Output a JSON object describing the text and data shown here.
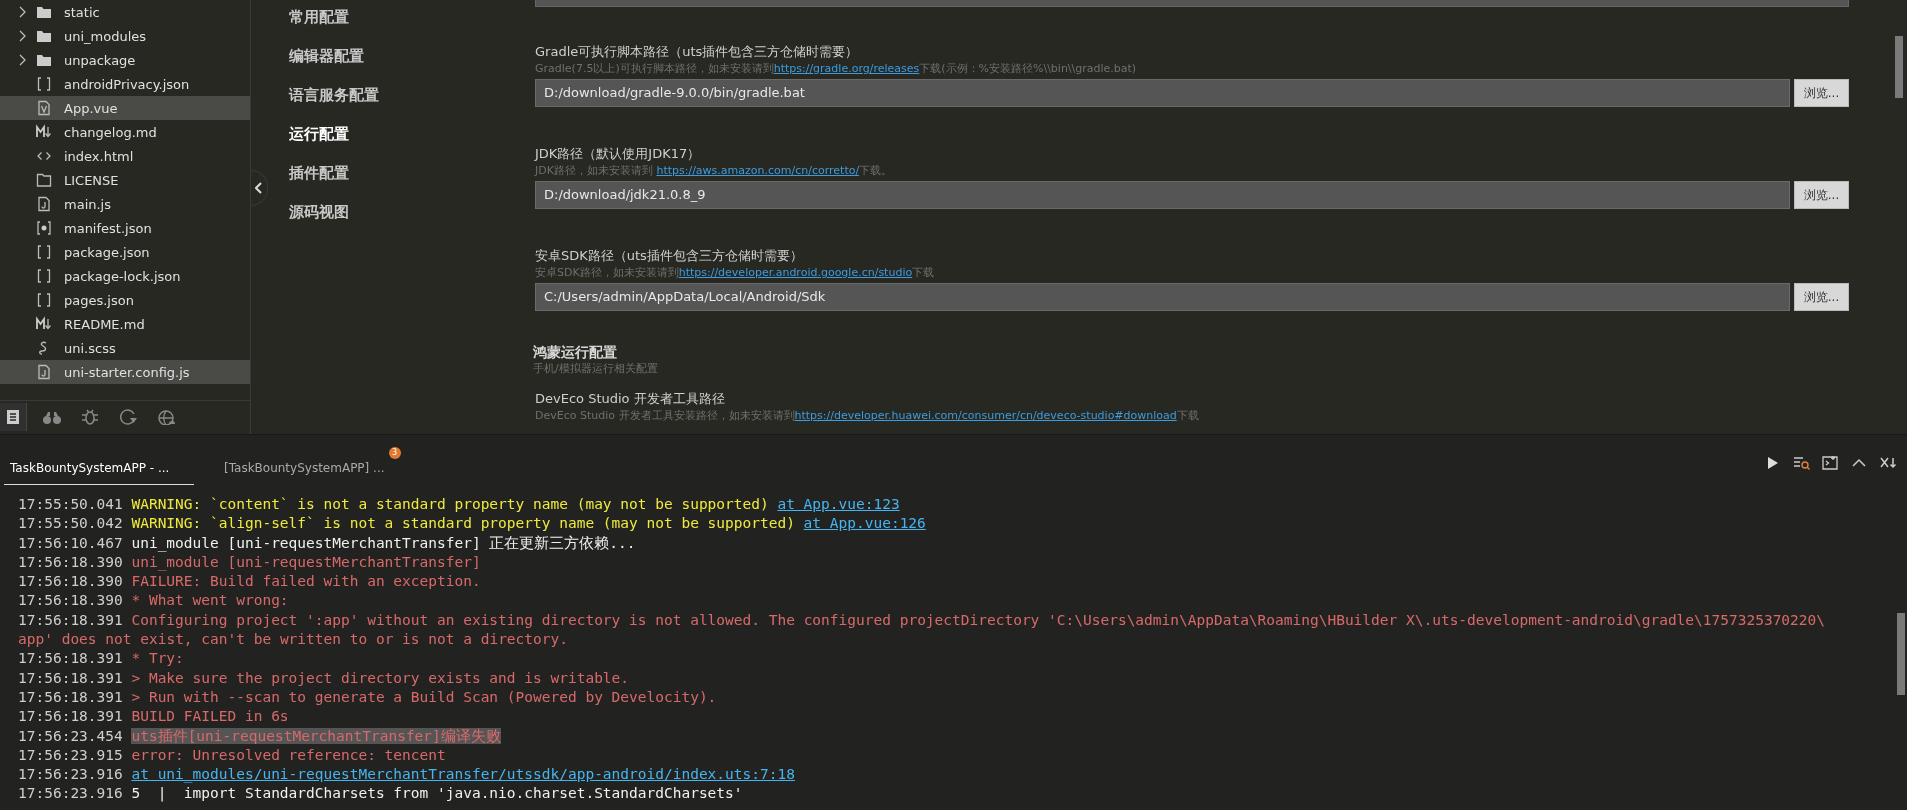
{
  "file_tree": {
    "items": [
      {
        "name": "static",
        "kind": "folder",
        "expandable": true,
        "selected": false
      },
      {
        "name": "uni_modules",
        "kind": "folder",
        "expandable": true,
        "selected": false
      },
      {
        "name": "unpackage",
        "kind": "folder",
        "expandable": true,
        "selected": false
      },
      {
        "name": "androidPrivacy.json",
        "kind": "brackets",
        "expandable": false,
        "selected": false
      },
      {
        "name": "App.vue",
        "kind": "vue",
        "expandable": false,
        "selected": true
      },
      {
        "name": "changelog.md",
        "kind": "markdown",
        "expandable": false,
        "selected": false
      },
      {
        "name": "index.html",
        "kind": "html",
        "expandable": false,
        "selected": false
      },
      {
        "name": "LICENSE",
        "kind": "file",
        "expandable": false,
        "selected": false
      },
      {
        "name": "main.js",
        "kind": "js",
        "expandable": false,
        "selected": false
      },
      {
        "name": "manifest.json",
        "kind": "manifest",
        "expandable": false,
        "selected": false
      },
      {
        "name": "package.json",
        "kind": "brackets",
        "expandable": false,
        "selected": false
      },
      {
        "name": "package-lock.json",
        "kind": "brackets",
        "expandable": false,
        "selected": false
      },
      {
        "name": "pages.json",
        "kind": "brackets",
        "expandable": false,
        "selected": false
      },
      {
        "name": "README.md",
        "kind": "markdown",
        "expandable": false,
        "selected": false
      },
      {
        "name": "uni.scss",
        "kind": "scss",
        "expandable": false,
        "selected": false
      },
      {
        "name": "uni-starter.config.js",
        "kind": "js",
        "expandable": false,
        "selected": true
      }
    ]
  },
  "activity_bar": [
    {
      "selected": true
    },
    {
      "selected": false
    },
    {
      "selected": false
    },
    {
      "selected": false
    },
    {
      "selected": false
    }
  ],
  "settings_nav": [
    {
      "label": "常用配置",
      "selected": false
    },
    {
      "label": "编辑器配置",
      "selected": false
    },
    {
      "label": "语言服务配置",
      "selected": false
    },
    {
      "label": "运行配置",
      "selected": true
    },
    {
      "label": "插件配置",
      "selected": false
    },
    {
      "label": "源码视图",
      "selected": false
    }
  ],
  "settings": [
    {
      "kind": "path",
      "title": "Gradle可执行脚本路径（uts插件包含三方仓储时需要）",
      "description": [
        {
          "text": "Gradle(7.5以上)可执行脚本路径，如未安装请到"
        },
        {
          "link": "https://gradle.org/releases"
        },
        {
          "text": "下载(示例：%安装路径%\\\\bin\\\\gradle.bat)"
        }
      ],
      "value": "D:/download/gradle-9.0.0/bin/gradle.bat",
      "button": "浏览..."
    },
    {
      "kind": "path",
      "title": "JDK路径（默认使用JDK17）",
      "description": [
        {
          "text": "JDK路径，如未安装请到 "
        },
        {
          "link": "https://aws.amazon.com/cn/corretto/"
        },
        {
          "text": "下载。"
        }
      ],
      "value": "D:/download/jdk21.0.8_9",
      "button": "浏览..."
    },
    {
      "kind": "path",
      "title": "安卓SDK路径（uts插件包含三方仓储时需要）",
      "description": [
        {
          "text": "安卓SDK路径，如未安装请到"
        },
        {
          "link": "https://developer.android.google.cn/studio"
        },
        {
          "text": "下载"
        }
      ],
      "value": "C:/Users/admin/AppData/Local/Android/Sdk",
      "button": "浏览..."
    },
    {
      "kind": "group",
      "title": "鸿蒙运行配置",
      "subtitle": "手机/模拟器运行相关配置"
    },
    {
      "kind": "path",
      "title": "DevEco Studio 开发者工具路径",
      "description": [
        {
          "text": "DevEco Studio 开发者工具安装路径，如未安装请到"
        },
        {
          "link": "https://developer.huawei.com/consumer/cn/deveco-studio#download"
        },
        {
          "text": "下载"
        }
      ]
    }
  ],
  "console": {
    "tabs": [
      {
        "label": "TaskBountySystemAPP - ...",
        "selected": true
      },
      {
        "label": "[TaskBountySystemAPP] ...",
        "selected": false,
        "badge": "3"
      }
    ],
    "lines": [
      {
        "time": "17:55:50.041",
        "segments": [
          {
            "kind": "warn",
            "text": "WARNING: `content` is not a standard property name (may not be supported)"
          },
          {
            "kind": "link",
            "text": "at App.vue:123"
          }
        ]
      },
      {
        "time": "17:55:50.042",
        "segments": [
          {
            "kind": "warn",
            "text": "WARNING: `align-self` is not a standard property name (may not be supported)"
          },
          {
            "kind": "link",
            "text": "at App.vue:126"
          }
        ]
      },
      {
        "time": "17:56:10.467",
        "segments": [
          {
            "kind": "info",
            "text": "uni_module [uni-requestMerchantTransfer] 正在更新三方依赖..."
          }
        ]
      },
      {
        "time": "17:56:18.390",
        "segments": [
          {
            "kind": "error",
            "text": "uni_module [uni-requestMerchantTransfer]"
          }
        ]
      },
      {
        "time": "17:56:18.390",
        "segments": [
          {
            "kind": "error",
            "text": "FAILURE: Build failed with an exception."
          }
        ]
      },
      {
        "time": "17:56:18.390",
        "segments": [
          {
            "kind": "error",
            "text": "* What went wrong:"
          }
        ]
      },
      {
        "time": "17:56:18.391",
        "segments": [
          {
            "kind": "error",
            "text": "Configuring project ':app' without an existing directory is not allowed. The configured projectDirectory 'C:\\Users\\admin\\AppData\\Roaming\\HBuilder X\\.uts-development-android\\gradle\\1757325370220\\"
          }
        ]
      },
      {
        "segments": [
          {
            "kind": "error",
            "text": "app' does not exist, can't be written to or is not a directory."
          }
        ]
      },
      {
        "time": "17:56:18.391",
        "segments": [
          {
            "kind": "error",
            "text": "* Try:"
          }
        ]
      },
      {
        "time": "17:56:18.391",
        "segments": [
          {
            "kind": "error",
            "text": "> Make sure the project directory exists and is writable."
          }
        ]
      },
      {
        "time": "17:56:18.391",
        "segments": [
          {
            "kind": "error",
            "text": "> Run with --scan to generate a Build Scan (Powered by Develocity)."
          }
        ]
      },
      {
        "time": "17:56:18.391",
        "segments": [
          {
            "kind": "error",
            "text": "BUILD FAILED in 6s"
          }
        ]
      },
      {
        "time": "17:56:23.454",
        "segments": [
          {
            "kind": "highlight",
            "text": "uts插件[uni-requestMerchantTransfer]编译失败"
          }
        ]
      },
      {
        "time": "17:56:23.915",
        "segments": [
          {
            "kind": "error",
            "text": "error: Unresolved reference: tencent"
          }
        ]
      },
      {
        "time": "17:56:23.916",
        "segments": [
          {
            "kind": "link",
            "text": "at uni_modules/uni-requestMerchantTransfer/utssdk/app-android/index.uts:7:18"
          }
        ]
      },
      {
        "time": "17:56:23.916",
        "segments": [
          {
            "kind": "info",
            "text": "5  |  import StandardCharsets from 'java.nio.charset.StandardCharsets'"
          }
        ]
      }
    ]
  }
}
